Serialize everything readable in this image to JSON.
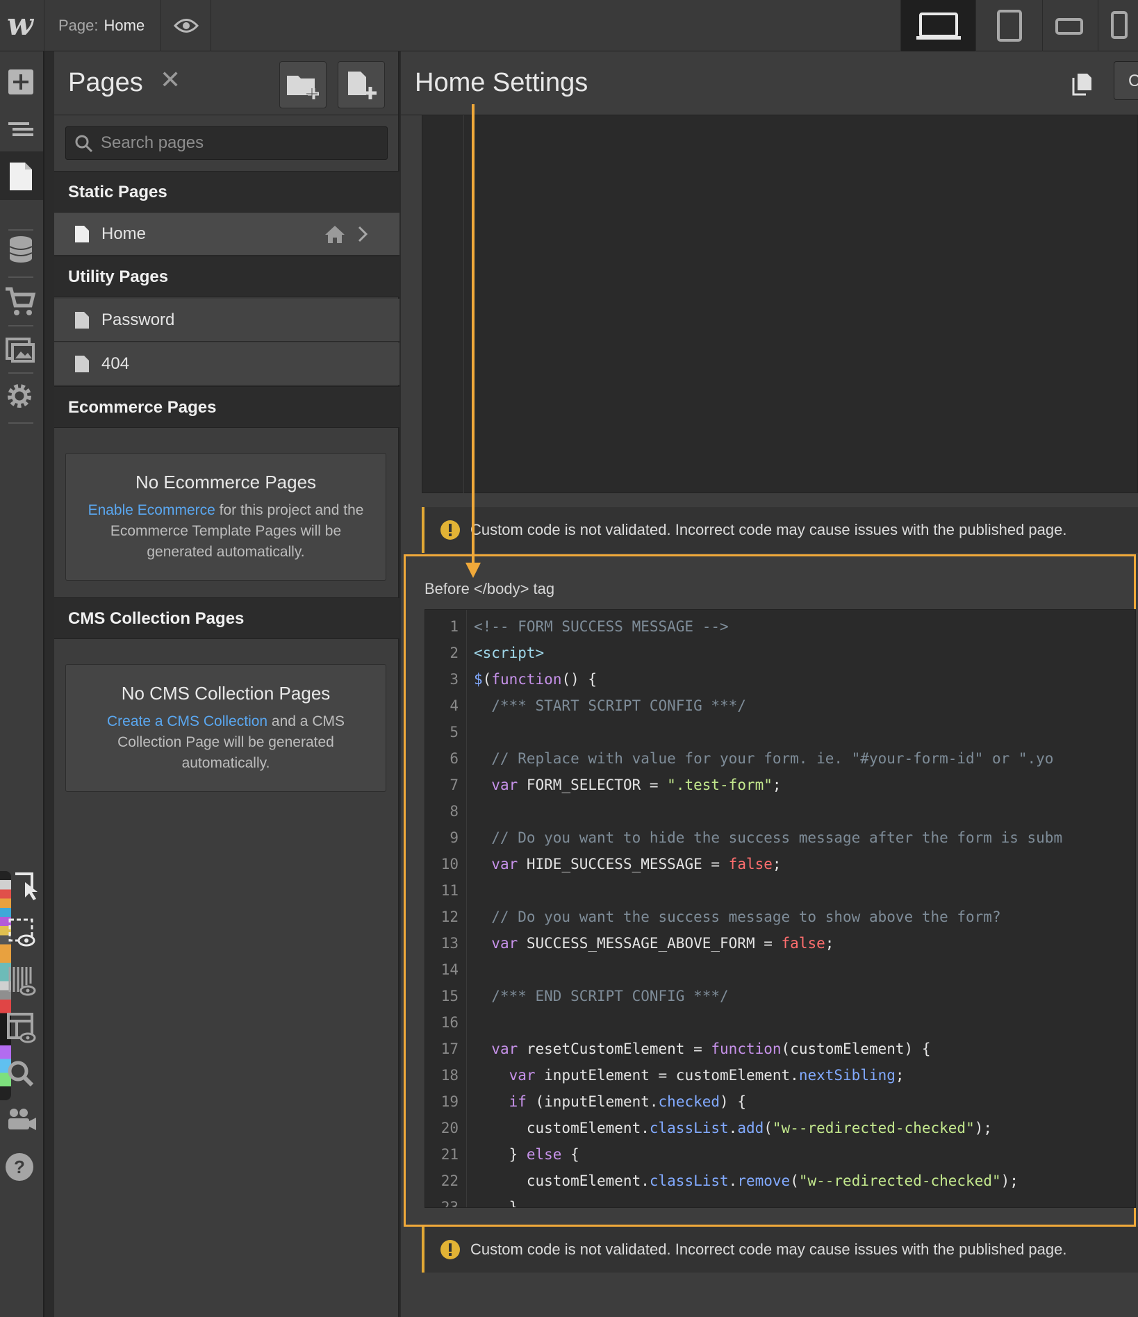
{
  "topbar": {
    "logo": "w",
    "page_prefix": "Page:",
    "page_name": "Home",
    "devices": [
      "desktop-icon",
      "tablet-icon",
      "mobile-landscape-icon",
      "mobile-portrait-icon"
    ]
  },
  "rail": {
    "icons": [
      "add-icon",
      "navigator-icon",
      "pages-icon",
      "cms-icon",
      "ecommerce-icon",
      "assets-icon",
      "settings-icon",
      "select-icon",
      "preview-element-icon",
      "audit-icon",
      "template-preview-icon",
      "search-icon",
      "users-icon",
      "help-icon"
    ]
  },
  "pages_panel": {
    "title": "Pages",
    "search_placeholder": "Search pages",
    "static_heading": "Static Pages",
    "static_pages": [
      {
        "label": "Home"
      }
    ],
    "utility_heading": "Utility Pages",
    "utility_pages": [
      {
        "label": "Password"
      },
      {
        "label": "404"
      }
    ],
    "ecommerce_heading": "Ecommerce Pages",
    "ecommerce_empty": {
      "title": "No Ecommerce Pages",
      "link": "Enable Ecommerce",
      "text_after_link": " for this project and the Ecommerce Template Pages will be generated automatically."
    },
    "cms_heading": "CMS Collection Pages",
    "cms_empty": {
      "title": "No CMS Collection Pages",
      "link": "Create a CMS Collection",
      "text_after_link": " and a CMS Collection Page will be generated automatically."
    }
  },
  "settings": {
    "title": "Home Settings",
    "action_label": "C",
    "warning": "Custom code is not validated. Incorrect code may cause issues with the published page.",
    "before_body_label": "Before </body> tag",
    "code_lines": [
      "<!-- FORM SUCCESS MESSAGE -->",
      "<script>",
      "$(function() {",
      "  /*** START SCRIPT CONFIG ***/",
      "",
      "  // Replace with value for your form. ie. \"#your-form-id\" or \".yo",
      "  var FORM_SELECTOR = \".test-form\";",
      "",
      "  // Do you want to hide the success message after the form is subm",
      "  var HIDE_SUCCESS_MESSAGE = false;",
      "",
      "  // Do you want the success message to show above the form?",
      "  var SUCCESS_MESSAGE_ABOVE_FORM = false;",
      "",
      "  /*** END SCRIPT CONFIG ***/",
      "",
      "  var resetCustomElement = function(customElement) {",
      "    var inputElement = customElement.nextSibling;",
      "    if (inputElement.checked) {",
      "      customElement.classList.add(\"w--redirected-checked\");",
      "    } else {",
      "      customElement.classList.remove(\"w--redirected-checked\");",
      "    }"
    ]
  },
  "colors": {
    "accent_orange": "#f0a93a",
    "link_blue": "#5aa7f0",
    "warning_yellow": "#e2a835"
  }
}
